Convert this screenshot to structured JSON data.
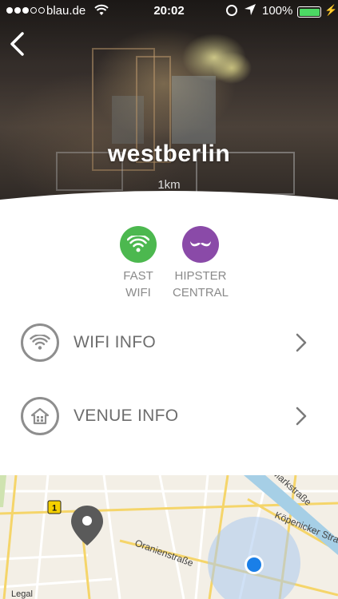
{
  "status_bar": {
    "carrier": "blau.de",
    "time": "20:02",
    "battery_percent": "100%",
    "signal_bars": 5,
    "signal_filled": 3
  },
  "venue": {
    "name": "westberlin",
    "distance": "1km"
  },
  "badges": [
    {
      "line1": "FAST",
      "line2": "WIFI",
      "icon": "wifi-icon",
      "color": "#4cb84f"
    },
    {
      "line1": "HIPSTER",
      "line2": "CENTRAL",
      "icon": "mustache-icon",
      "color": "#8a4aa8"
    }
  ],
  "info_rows": [
    {
      "label": "WIFI INFO",
      "icon": "wifi-icon"
    },
    {
      "label": "VENUE INFO",
      "icon": "house-icon"
    }
  ],
  "map": {
    "streets": [
      "Oranienstraße",
      "Köpenicker Straße",
      "Markstraße"
    ],
    "route_badge": "1",
    "legal": "Legal"
  },
  "colors": {
    "wifi_green": "#4cb84f",
    "hipster_purple": "#8a4aa8",
    "user_location_blue": "#1a7fe8",
    "pin_gray": "#5a5a5a"
  }
}
